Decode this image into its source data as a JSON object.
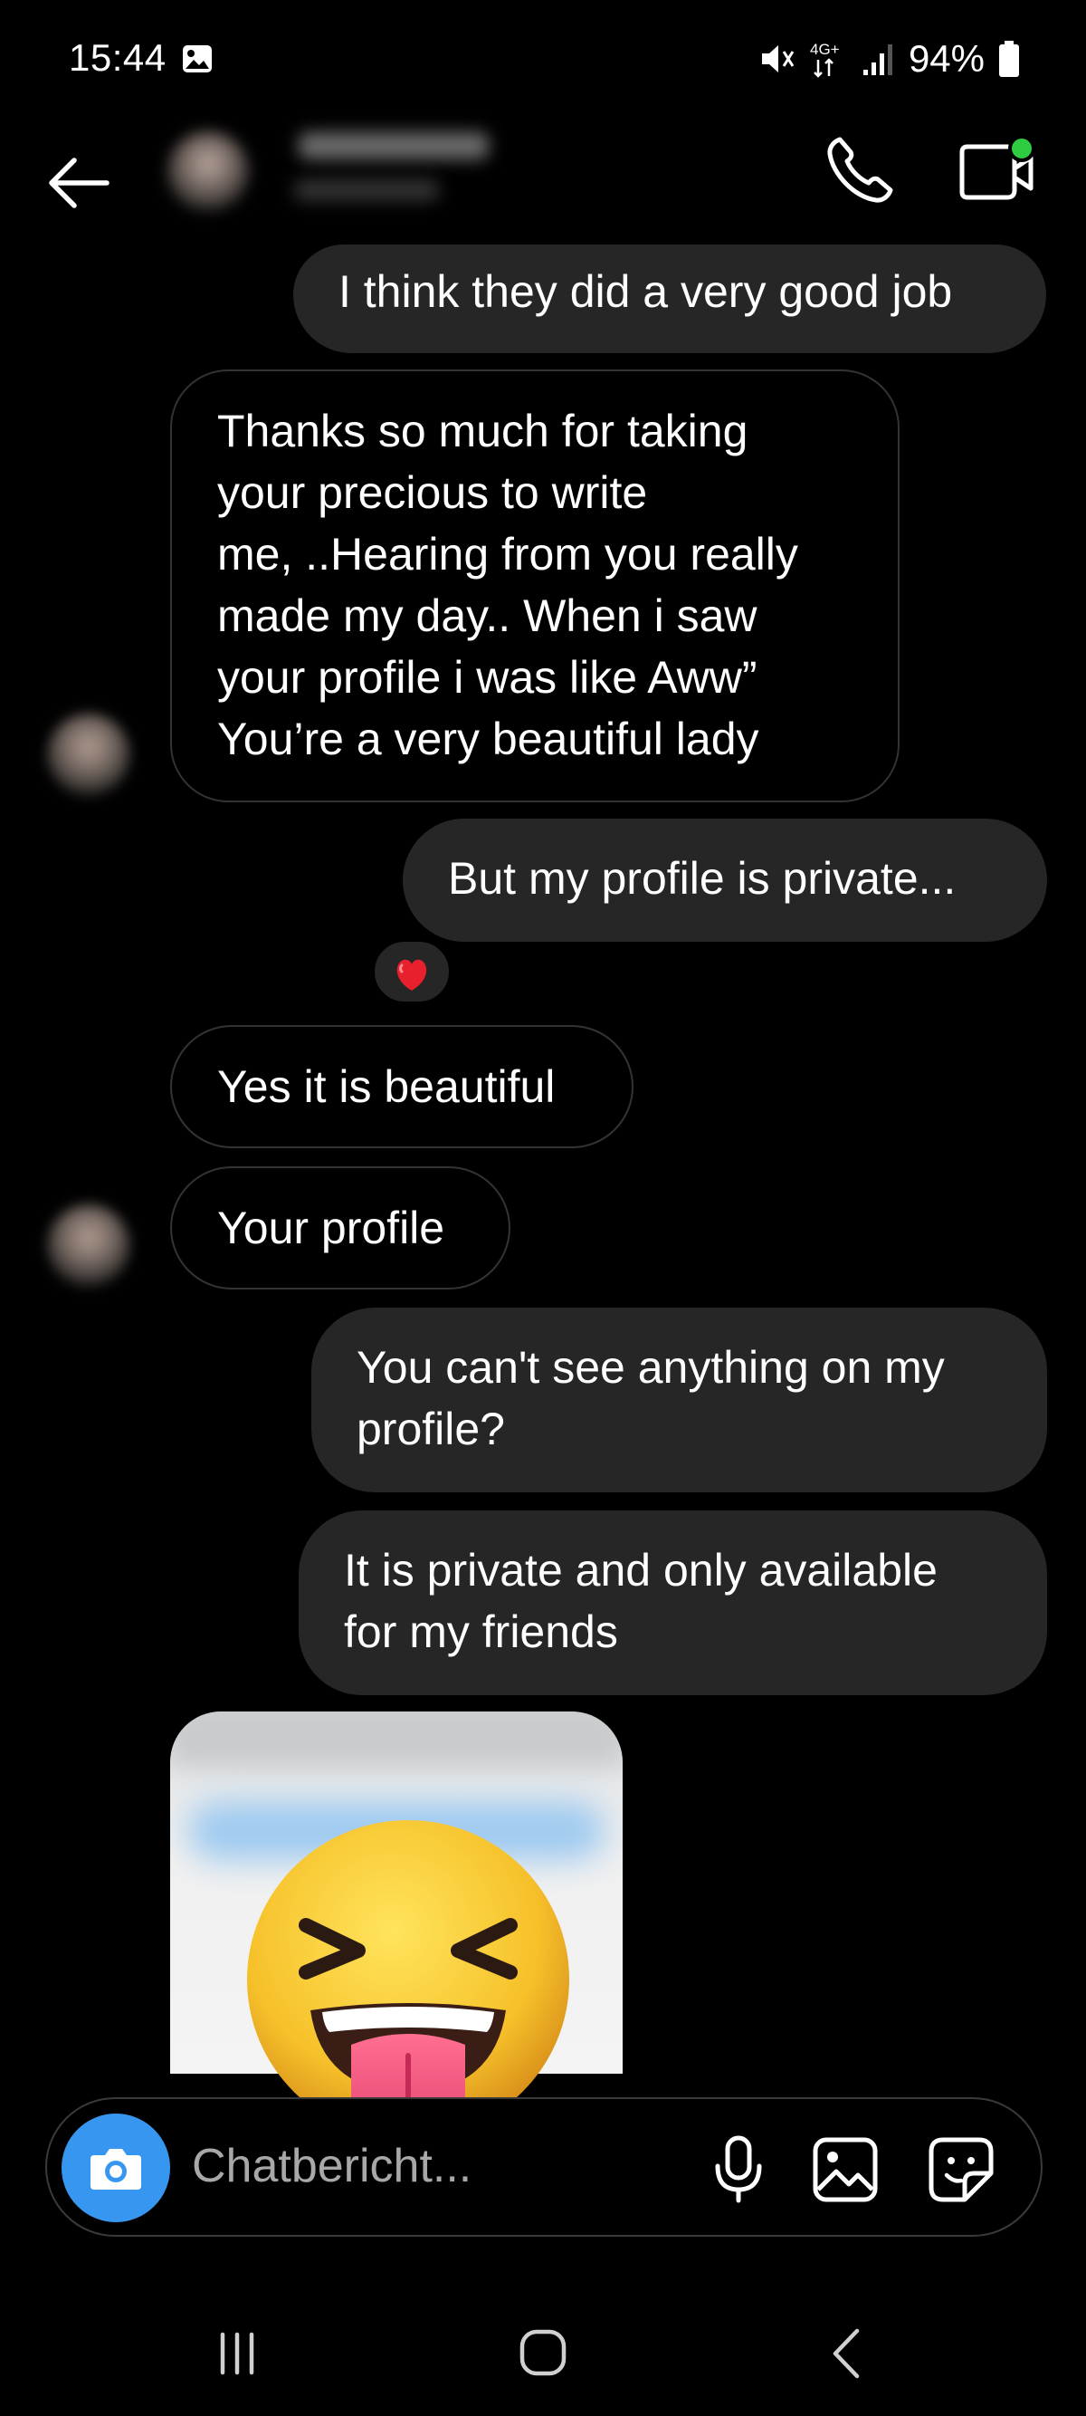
{
  "status_bar": {
    "time": "15:44",
    "network": "4G+",
    "battery": "94%"
  },
  "header": {
    "contact_name": "",
    "contact_status": ""
  },
  "messages": [
    {
      "direction": "sent",
      "text": "I think they did a very good job"
    },
    {
      "direction": "received",
      "text": "Thanks so much for taking\nyour precious to write\nme, ..Hearing from you really\nmade my day..  When i saw\nyour profile i was like Aww”\nYou’re a very beautiful lady"
    },
    {
      "direction": "sent",
      "text": "But my profile is private...",
      "reaction": "❤️"
    },
    {
      "direction": "received",
      "text": "Yes it is beautiful"
    },
    {
      "direction": "received",
      "text": "Your profile"
    },
    {
      "direction": "sent",
      "text": "You can't see anything on my\nprofile?"
    },
    {
      "direction": "sent",
      "text": "It is private and only available\nfor my friends"
    }
  ],
  "composer": {
    "placeholder": "Chatbericht..."
  },
  "icons": {
    "back": "arrow-left-icon",
    "call": "phone-icon",
    "video": "video-camera-icon",
    "camera": "camera-icon",
    "mic": "microphone-icon",
    "gallery": "image-icon",
    "sticker": "sticker-icon"
  },
  "colors": {
    "background": "#000000",
    "sent_bubble": "#262626",
    "camera_button": "#3797f0",
    "online_dot": "#2ecc40"
  }
}
